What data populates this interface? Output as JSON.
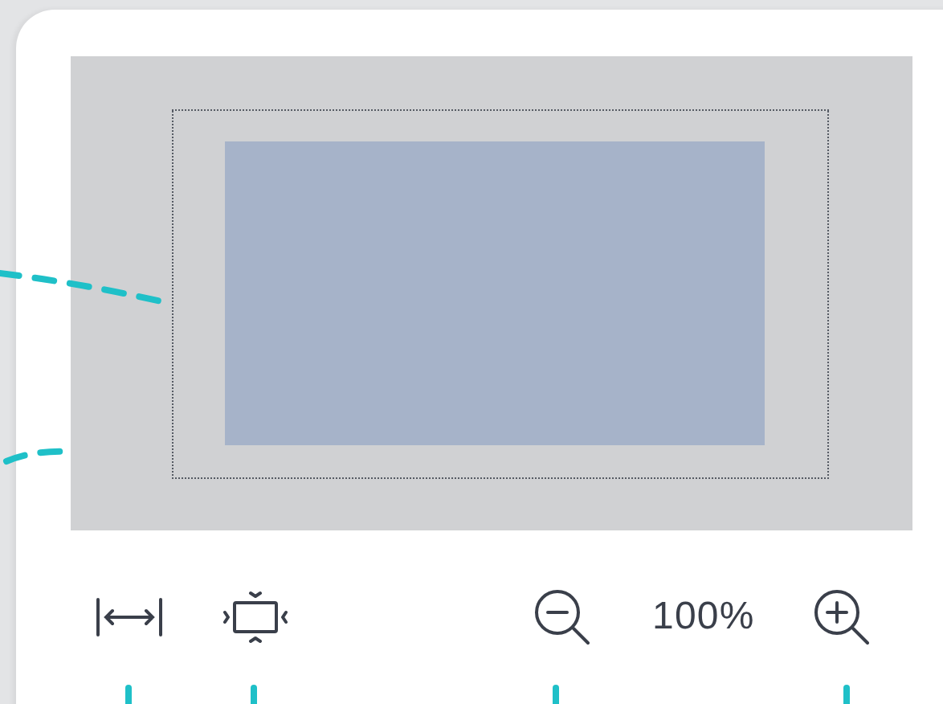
{
  "toolbar": {
    "zoom_level": "100%"
  }
}
